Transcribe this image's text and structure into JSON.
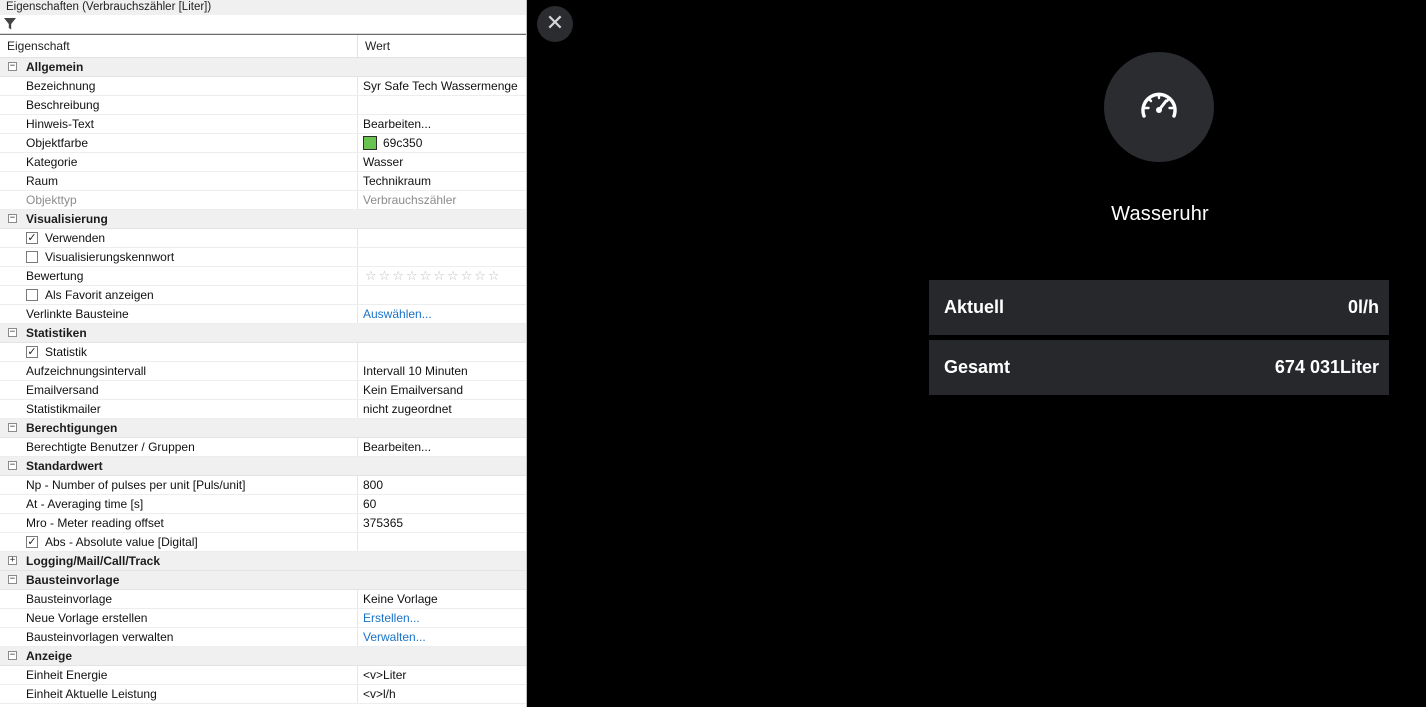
{
  "panel": {
    "title": "Eigenschaften (Verbrauchszähler [Liter])",
    "col_property": "Eigenschaft",
    "col_value": "Wert",
    "rows": [
      {
        "kind": "cat",
        "label": "Allgemein",
        "expander": "−"
      },
      {
        "kind": "prop",
        "label": "Bezeichnung",
        "value": "Syr Safe Tech Wassermenge"
      },
      {
        "kind": "prop",
        "label": "Beschreibung",
        "value": ""
      },
      {
        "kind": "prop",
        "label": "Hinweis-Text",
        "value": "Bearbeiten..."
      },
      {
        "kind": "prop",
        "label": "Objektfarbe",
        "value": "69c350",
        "swatch": "#69c350"
      },
      {
        "kind": "prop",
        "label": "Kategorie",
        "value": "Wasser"
      },
      {
        "kind": "prop",
        "label": "Raum",
        "value": "Technikraum"
      },
      {
        "kind": "prop",
        "label": "Objekttyp",
        "value": "Verbrauchszähler",
        "disabled": true
      },
      {
        "kind": "cat",
        "label": "Visualisierung",
        "expander": "−"
      },
      {
        "kind": "prop",
        "label": "Verwenden",
        "value": "",
        "checkbox": true,
        "checked": true
      },
      {
        "kind": "prop",
        "label": "Visualisierungskennwort",
        "value": "",
        "checkbox": true,
        "checked": false
      },
      {
        "kind": "prop",
        "label": "Bewertung",
        "value": "",
        "stars": 10,
        "rating": 0
      },
      {
        "kind": "prop",
        "label": "Als Favorit anzeigen",
        "value": "",
        "checkbox": true,
        "checked": false
      },
      {
        "kind": "prop",
        "label": "Verlinkte Bausteine",
        "value": "Auswählen...",
        "link": true
      },
      {
        "kind": "cat",
        "label": "Statistiken",
        "expander": "−"
      },
      {
        "kind": "prop",
        "label": "Statistik",
        "value": "",
        "checkbox": true,
        "checked": true
      },
      {
        "kind": "prop",
        "label": "Aufzeichnungsintervall",
        "value": "Intervall 10 Minuten"
      },
      {
        "kind": "prop",
        "label": "Emailversand",
        "value": "Kein Emailversand"
      },
      {
        "kind": "prop",
        "label": "Statistikmailer",
        "value": "nicht zugeordnet"
      },
      {
        "kind": "cat",
        "label": "Berechtigungen",
        "expander": "−"
      },
      {
        "kind": "prop",
        "label": "Berechtigte Benutzer / Gruppen",
        "value": "Bearbeiten..."
      },
      {
        "kind": "cat",
        "label": "Standardwert",
        "expander": "−"
      },
      {
        "kind": "prop",
        "label": "Np - Number of pulses per unit [Puls/unit]",
        "value": "800"
      },
      {
        "kind": "prop",
        "label": "At - Averaging time [s]",
        "value": "60"
      },
      {
        "kind": "prop",
        "label": "Mro - Meter reading offset",
        "value": "375365"
      },
      {
        "kind": "prop",
        "label": "Abs - Absolute value [Digital]",
        "value": "",
        "checkbox": true,
        "checked": true
      },
      {
        "kind": "cat",
        "label": "Logging/Mail/Call/Track",
        "expander": "+"
      },
      {
        "kind": "cat",
        "label": "Bausteinvorlage",
        "expander": "−"
      },
      {
        "kind": "prop",
        "label": "Bausteinvorlage",
        "value": "Keine Vorlage"
      },
      {
        "kind": "prop",
        "label": "Neue Vorlage erstellen",
        "value": "Erstellen...",
        "link": true
      },
      {
        "kind": "prop",
        "label": "Bausteinvorlagen verwalten",
        "value": "Verwalten...",
        "link": true
      },
      {
        "kind": "cat",
        "label": "Anzeige",
        "expander": "−"
      },
      {
        "kind": "prop",
        "label": "Einheit Energie",
        "value": "<v>Liter"
      },
      {
        "kind": "prop",
        "label": "Einheit Aktuelle Leistung",
        "value": "<v>l/h"
      }
    ]
  },
  "viewer": {
    "close_glyph": "✕",
    "icon": "speedometer-icon",
    "device_name": "Wasseruhr",
    "cards": {
      "aktuell_label": "Aktuell",
      "aktuell_value": "0l/h",
      "gesamt_label": "Gesamt",
      "gesamt_value": "674 031Liter"
    }
  },
  "colors": {
    "accent_link": "#1a73c8",
    "object_color": "#69c350",
    "card_bg": "#26282c"
  }
}
